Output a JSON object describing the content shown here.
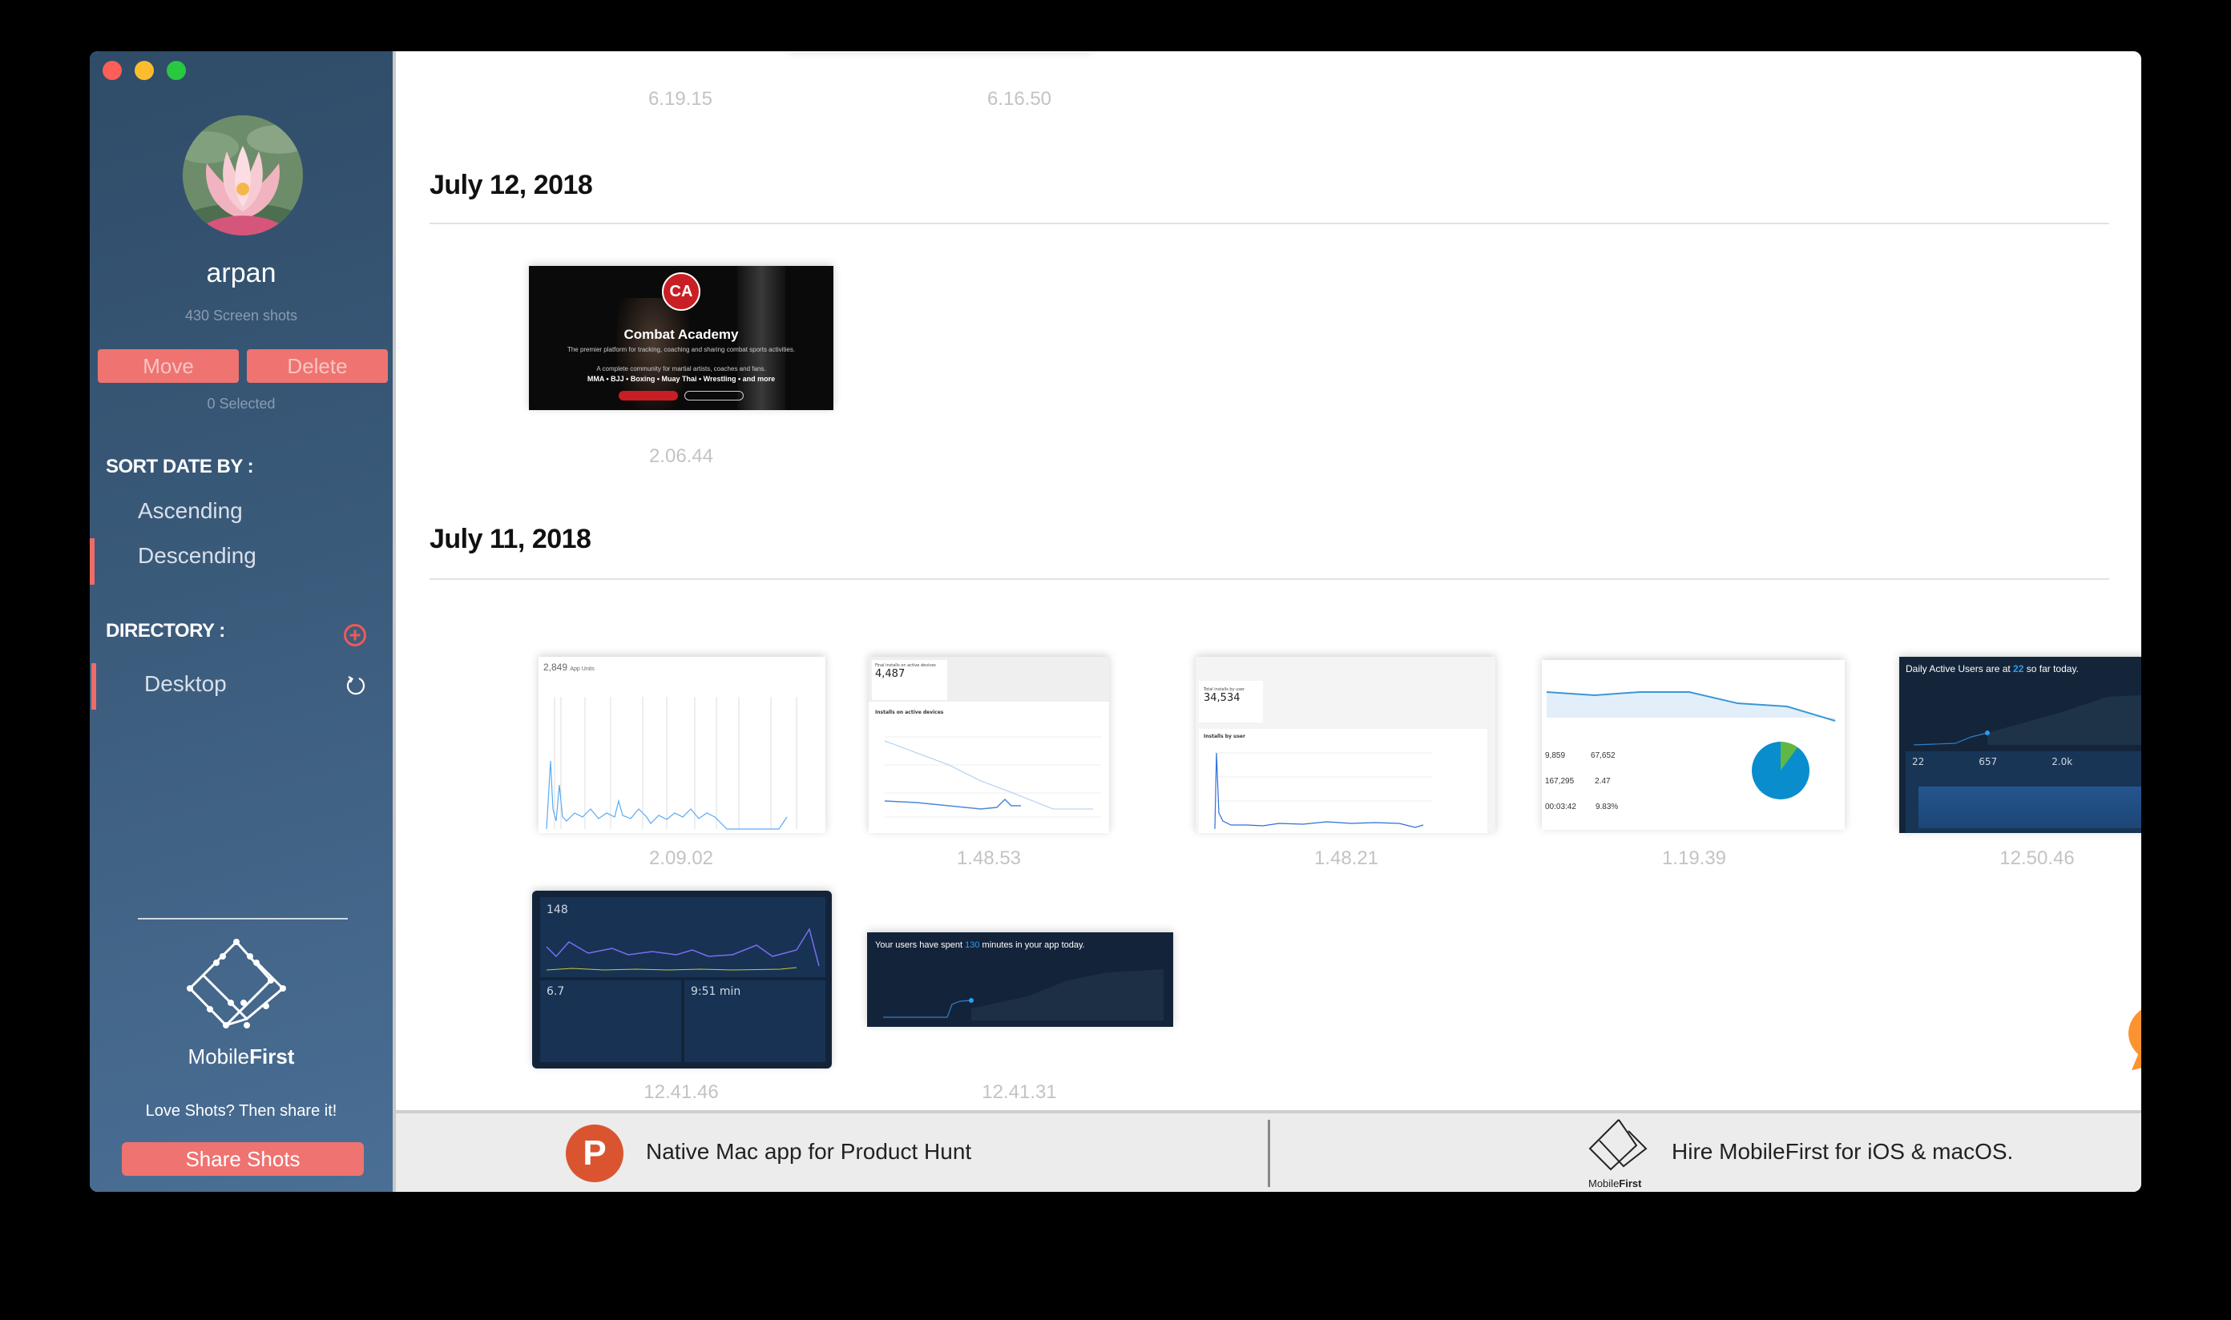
{
  "window": {
    "controls": [
      "close",
      "minimize",
      "maximize"
    ]
  },
  "sidebar": {
    "username": "arpan",
    "shot_count": "430 Screen shots",
    "move_label": "Move",
    "delete_label": "Delete",
    "selected_count": "0 Selected",
    "sort_heading": "SORT DATE BY :",
    "sort_options": [
      {
        "label": "Ascending",
        "active": false
      },
      {
        "label": "Descending",
        "active": true
      }
    ],
    "directory_heading": "DIRECTORY :",
    "directories": [
      {
        "label": "Desktop",
        "active": true
      }
    ],
    "brand_light": "Mobile",
    "brand_bold": "First",
    "love_text": "Love Shots? Then share it!",
    "share_label": "Share Shots"
  },
  "main": {
    "top_row_captions": [
      "6.19.15",
      "6.16.50"
    ],
    "groups": [
      {
        "date": "July 12, 2018",
        "shots": [
          {
            "time": "2.06.44",
            "title": "Combat Academy",
            "subtitle": "The premier platform for tracking, coaching and sharing combat sports activities.",
            "subtitle2": "A complete community for martial artists, coaches and fans.",
            "tags": "MMA • BJJ • Boxing • Muay Thai • Wrestling • and more",
            "logo": "CA"
          }
        ]
      },
      {
        "date": "July 11, 2018",
        "shots": [
          {
            "time": "2.09.02",
            "kpi": "2,849",
            "kpi_label": "App Units"
          },
          {
            "time": "1.48.53",
            "kpi": "4,487",
            "kpi_label": "Final installs on active devices",
            "chart_label": "Installs on active devices"
          },
          {
            "time": "1.48.21",
            "kpi": "34,534",
            "kpi_label": "Total installs by user",
            "chart_label": "Installs by user"
          },
          {
            "time": "1.19.39",
            "stats": [
              "9,859",
              "67,652",
              "167,295",
              "2.47",
              "00:03:42",
              "9.83%"
            ]
          },
          {
            "time": "12.50.46",
            "headline_pre": "Daily Active Users are at ",
            "headline_num": "22",
            "headline_post": " so far today.",
            "metrics": [
              "22",
              "657",
              "2.0k"
            ]
          },
          {
            "time": "12.41.46",
            "metrics": [
              "148",
              "6.7",
              "9:51 min"
            ]
          },
          {
            "time": "12.41.31",
            "headline_pre": "Your users have spent ",
            "headline_num": "130",
            "headline_post": " minutes in your app today."
          }
        ]
      }
    ]
  },
  "footer": {
    "product_hunt_text": "Native Mac app for Product Hunt",
    "product_hunt_glyph": "P",
    "hire_text": "Hire MobileFirst for iOS & macOS.",
    "hire_brand": "MobileFirst"
  },
  "colors": {
    "accent": "#ef7370",
    "sidebar_top": "#2f4c68",
    "sidebar_bottom": "#4a6f95",
    "product_hunt": "#da552f",
    "chat": "#fd9330"
  }
}
